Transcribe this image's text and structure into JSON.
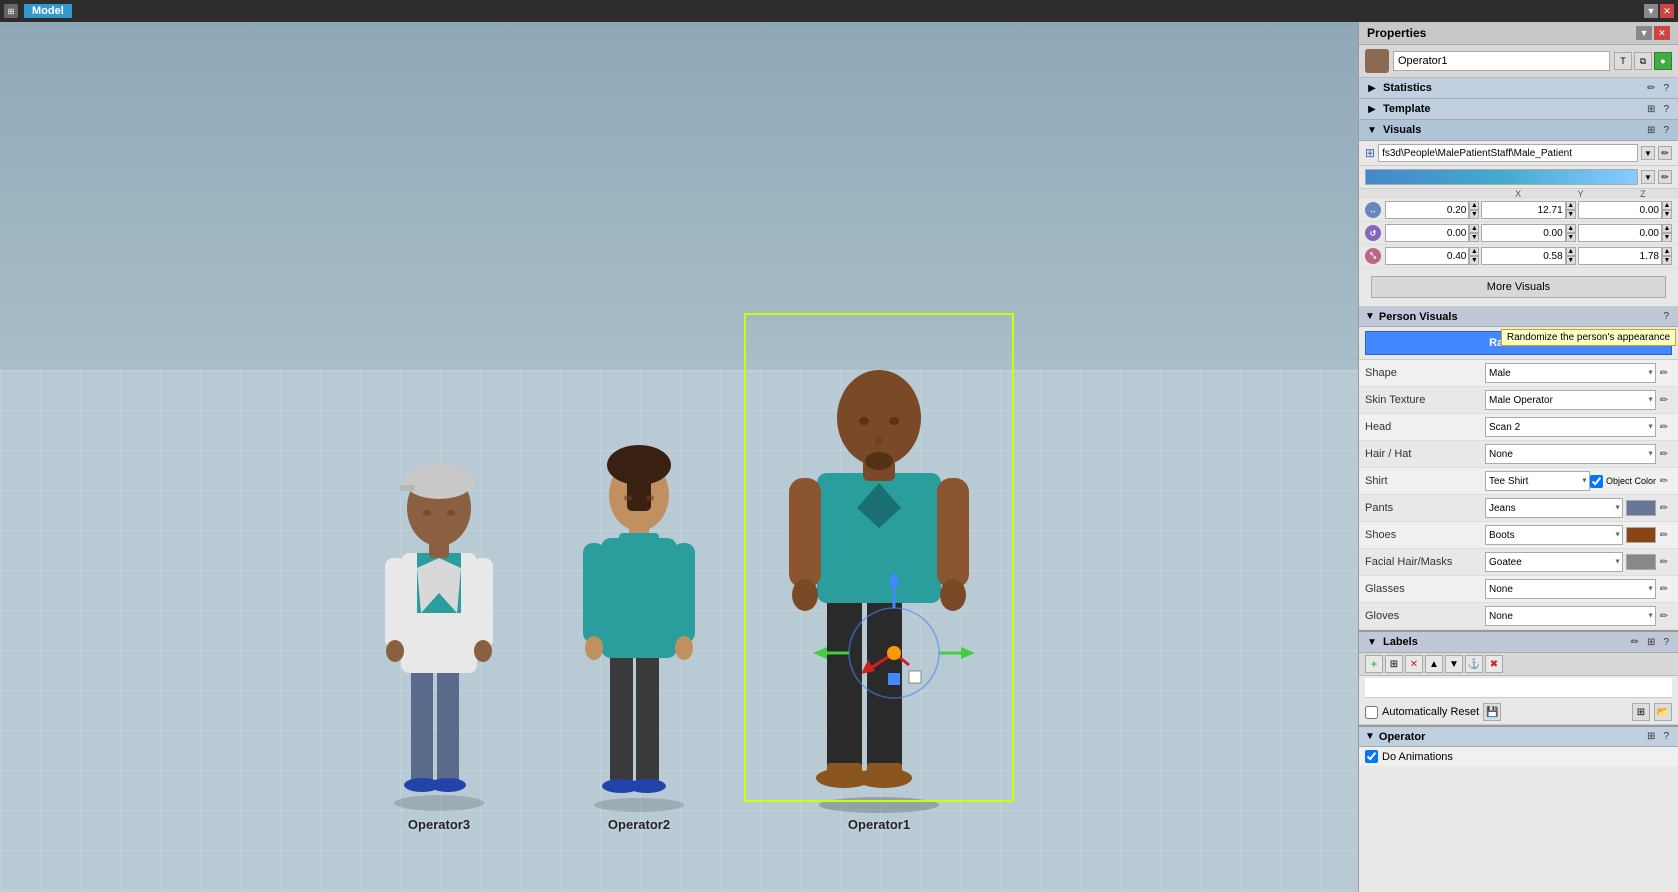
{
  "window": {
    "title": "Model",
    "close_btn": "✕",
    "collapse_btn": "▼"
  },
  "viewport": {
    "characters": [
      {
        "id": "op3",
        "label": "Operator3",
        "selected": false
      },
      {
        "id": "op2",
        "label": "Operator2",
        "selected": false
      },
      {
        "id": "op1",
        "label": "Operator1",
        "selected": true
      }
    ]
  },
  "properties": {
    "panel_title": "Properties",
    "operator_name": "Operator1",
    "sections": {
      "statistics": {
        "label": "Statistics"
      },
      "template": {
        "label": "Template"
      },
      "visuals": {
        "label": "Visuals"
      }
    },
    "path": "fs3d\\People\\MalePatientStaff\\Male_Patient",
    "xyz": {
      "x_label": "X",
      "y_label": "Y",
      "z_label": "Z",
      "translate": {
        "x": "0.20",
        "y": "12.71",
        "z": "0.00"
      },
      "rotate": {
        "x": "0.00",
        "y": "0.00",
        "z": "0.00"
      },
      "scale": {
        "x": "0.40",
        "y": "0.58",
        "z": "1.78"
      }
    },
    "more_visuals_btn": "More Visuals",
    "person_visuals": "Person Visuals",
    "randomize_btn": "Randomize",
    "randomize_tooltip": "Randomize the person's appearance",
    "props": [
      {
        "label": "Shape",
        "value": "Male",
        "has_color": false,
        "key": "shape"
      },
      {
        "label": "Skin Texture",
        "value": "Male Operator",
        "has_color": false,
        "key": "skin_texture"
      },
      {
        "label": "Head",
        "value": "Scan 2",
        "has_color": false,
        "key": "head"
      },
      {
        "label": "Hair / Hat",
        "value": "None",
        "has_color": false,
        "key": "hair_hat"
      },
      {
        "label": "Shirt",
        "value": "Tee Shirt",
        "has_color": true,
        "checkbox": "Object Color",
        "key": "shirt"
      },
      {
        "label": "Pants",
        "value": "Jeans",
        "has_color": true,
        "key": "pants"
      },
      {
        "label": "Shoes",
        "value": "Boots",
        "has_color": true,
        "key": "shoes",
        "color": "#8B4513"
      },
      {
        "label": "Facial Hair/Masks",
        "value": "Goatee",
        "has_color": true,
        "key": "facial_hair",
        "color": "#888"
      },
      {
        "label": "Glasses",
        "value": "None",
        "has_color": false,
        "key": "glasses"
      },
      {
        "label": "Gloves",
        "value": "None",
        "has_color": false,
        "key": "gloves"
      }
    ],
    "labels_section": "Labels",
    "auto_reset": "Automatically Reset",
    "operator_section": "Operator",
    "do_animations": "Do Animations"
  }
}
